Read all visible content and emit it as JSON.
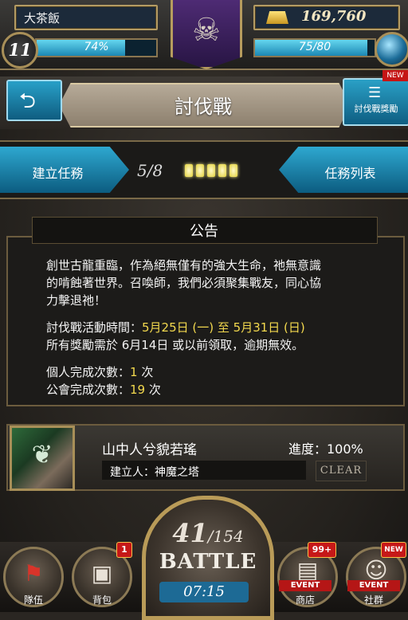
{
  "header": {
    "player_name": "大茶飯",
    "level": "11",
    "exp_percent_text": "74%",
    "exp_fraction": 0.74,
    "gold": "169,760",
    "stamina_text": "75/80",
    "stamina_fraction": 0.9375
  },
  "title_bar": {
    "back_icon": "back-arrow-icon",
    "title": "討伐戰",
    "reward_button_label": "討伐戰獎勵",
    "reward_new_tag": "NEW"
  },
  "mission_bar": {
    "create_label": "建立任務",
    "progress": "5/8",
    "pips_filled": 5,
    "list_label": "任務列表"
  },
  "notice": {
    "title": "公告",
    "lines": [
      "創世古龍重臨，作為絕無僅有的強大生命，祂無意識",
      "的啃蝕著世界。召喚師，我們必須聚集戰友，同心協",
      "力擊退祂！"
    ],
    "period_label": "討伐戰活動時間：",
    "period_value": "5月25日 (一) 至 5月31日 (日)",
    "claim_line": "所有獎勵需於 6月14日 或以前領取，逾期無效。",
    "personal_label": "個人完成次數：",
    "personal_count": "1",
    "guild_label": "公會完成次數：",
    "guild_count": "19",
    "unit": " 次"
  },
  "task": {
    "name": "山中人兮貌若瑤",
    "progress_label": "進度：100%",
    "creator_label": "建立人：神魔之塔",
    "clear_label": "CLEAR"
  },
  "bottom_nav": {
    "team_label": "隊伍",
    "bag_label": "背包",
    "bag_badge": "1",
    "battle_count": "41",
    "battle_total": "/154",
    "battle_label": "BATTLE",
    "battle_timer": "07:15",
    "shop_event": "EVENT",
    "shop_label": "商店",
    "shop_badge": "99+",
    "social_event": "EVENT",
    "social_label": "社群",
    "social_new": "NEW"
  }
}
